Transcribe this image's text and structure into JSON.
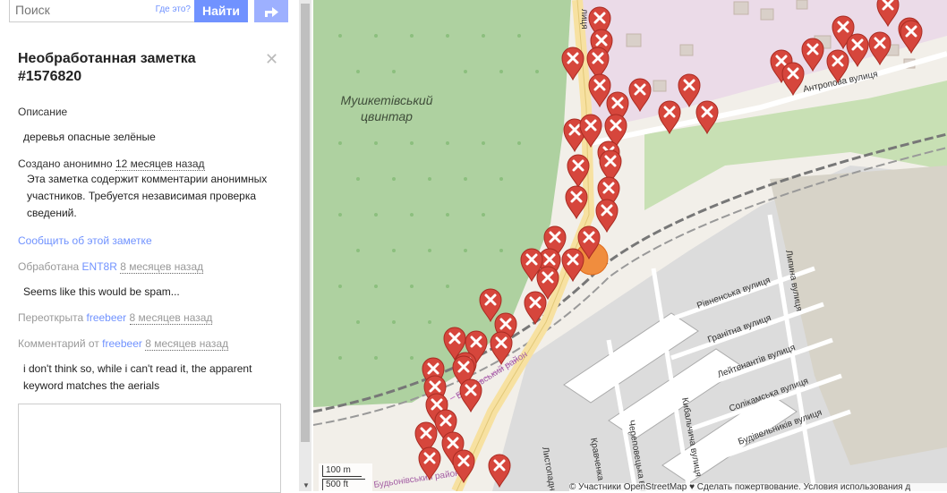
{
  "search": {
    "placeholder": "Поиск",
    "where_link": "Где это?",
    "go_label": "Найти"
  },
  "note": {
    "title": "Необработанная заметка #1576820",
    "description_heading": "Описание",
    "description": "деревья опасные зелёные",
    "created_prefix": "Создано анонимно",
    "created_time": "12 месяцев назад",
    "anon_warning": "Эта заметка содержит комментарии анонимных участников. Требуется независимая проверка сведений.",
    "report_link": "Сообщить об этой заметке",
    "events": [
      {
        "prefix": "Обработана",
        "user": "ENT8R",
        "time": "8 месяцев назад",
        "comment": "Seems like this would be spam..."
      },
      {
        "prefix": "Переоткрыта",
        "user": "freebeer",
        "time": "8 месяцев назад",
        "comment": ""
      },
      {
        "prefix": "Комментарий от",
        "user": "freebeer",
        "time": "8 месяцев назад",
        "comment": "i don't think so, while i can't read it, the apparent keyword matches the aerials"
      }
    ]
  },
  "map": {
    "area_label_1": "Мушкетівський",
    "area_label_2": "цвинтар",
    "streets": [
      "Рівненська вулиця",
      "Гранітна вулиця",
      "Лейтенантів вулиця",
      "Солікамська вулиця",
      "Будівельників вулиця",
      "Кибальчича вулиця",
      "Череповецька вулиця",
      "Кравченка",
      "Листопадна",
      "Липина вулиця",
      "Антропова вулиця",
      "лиця",
      "Буденівський район",
      "Будьонівський район"
    ],
    "scale_metric": "100 m",
    "scale_imperial": "500 ft",
    "attribution": "© Участники OpenStreetMap ♥ Сделать пожертвование. Условия использования д",
    "colors": {
      "cemetery": "#aed1a0",
      "residential": "#e0dfdf",
      "commercial": "#f2dad9",
      "industrial": "#ebdbe8",
      "road_major": "#fcd6a4",
      "marker": "#d6463c",
      "selected": "#f08d3e"
    }
  }
}
